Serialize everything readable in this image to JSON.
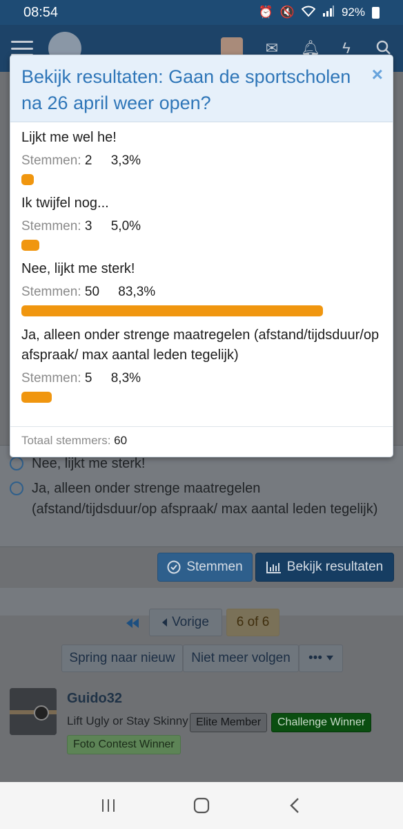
{
  "status_bar": {
    "time": "08:54",
    "battery": "92%"
  },
  "modal": {
    "title": "Bekijk resultaten: Gaan de sportscholen na 26 april weer open?",
    "close_symbol": "×",
    "votes_label": "Stemmen:",
    "options": [
      {
        "label": "Lijkt me wel he!",
        "votes": "2",
        "percent": "3,3%",
        "fraction": 0.033
      },
      {
        "label": "Ik twijfel nog...",
        "votes": "3",
        "percent": "5,0%",
        "fraction": 0.05
      },
      {
        "label": "Nee, lijkt me sterk!",
        "votes": "50",
        "percent": "83,3%",
        "fraction": 0.833
      },
      {
        "label": "Ja, alleen onder strenge maatregelen (afstand/tijdsduur/op afspraak/ max aantal leden tegelijk)",
        "votes": "5",
        "percent": "8,3%",
        "fraction": 0.083
      }
    ],
    "total_label": "Totaal stemmers:",
    "total_value": "60",
    "bar_color": "#f0960f"
  },
  "background_poll": {
    "options": [
      "Nee, lijkt me sterk!",
      "Ja, alleen onder strenge maatregelen (afstand/tijdsduur/op afspraak/ max aantal leden tegelijk)"
    ],
    "vote_button": "Stemmen",
    "results_button": "Bekijk resultaten"
  },
  "pager": {
    "prev_label": "Vorige",
    "current": "6 of 6",
    "jump_new": "Spring naar nieuw",
    "unfollow": "Niet meer volgen",
    "more": "•••"
  },
  "post_user": {
    "name": "Guido32",
    "title": "Lift Ugly or Stay Skinny",
    "badges": [
      "Elite Member",
      "Challenge Winner",
      "Foto Contest Winner"
    ]
  }
}
